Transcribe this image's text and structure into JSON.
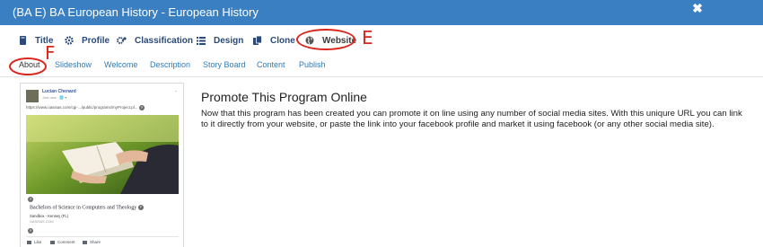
{
  "window": {
    "title": "(BA E) BA European History - European History",
    "close_icon": "close-icon"
  },
  "main_tabs": [
    {
      "label": "Title",
      "icon": "book-icon"
    },
    {
      "label": "Profile",
      "icon": "gear-icon"
    },
    {
      "label": "Classification",
      "icon": "gears-icon"
    },
    {
      "label": "Design",
      "icon": "list-icon"
    },
    {
      "label": "Clone",
      "icon": "copy-icon"
    },
    {
      "label": "Website",
      "icon": "globe-icon",
      "active": true
    }
  ],
  "annotations": {
    "letter_e": "E",
    "letter_f": "F",
    "color": "#d9261c"
  },
  "sub_tabs": [
    {
      "label": "About",
      "active": true
    },
    {
      "label": "Slideshow"
    },
    {
      "label": "Welcome"
    },
    {
      "label": "Description"
    },
    {
      "label": "Story Board"
    },
    {
      "label": "Content"
    },
    {
      "label": "Publish"
    }
  ],
  "preview": {
    "author": "Lucian Chenard",
    "meta": "Just now · 🌐 ▾",
    "url": "https://www.oasisas.com/cgi-.../public/programs/myProject.pl...",
    "headline": "Bachelors of Science in Computers and Theology",
    "location": "Sandbox - Kensey (FL)",
    "domain": "OASISAS.COM",
    "actions": [
      "Like",
      "Comment",
      "Share"
    ]
  },
  "content": {
    "title": "Promote This Program Online",
    "body": "Now that this program has been created you can promote it on line using any number of social media sites. With this uniqure URL you can link to it directly from your website, or paste the link into your facebook profile and market it using facebook (or any other social media site)."
  },
  "colors": {
    "header": "#3a7fc2",
    "tab_text": "#2b4a77",
    "link": "#337ab7",
    "annotation": "#d9261c"
  }
}
